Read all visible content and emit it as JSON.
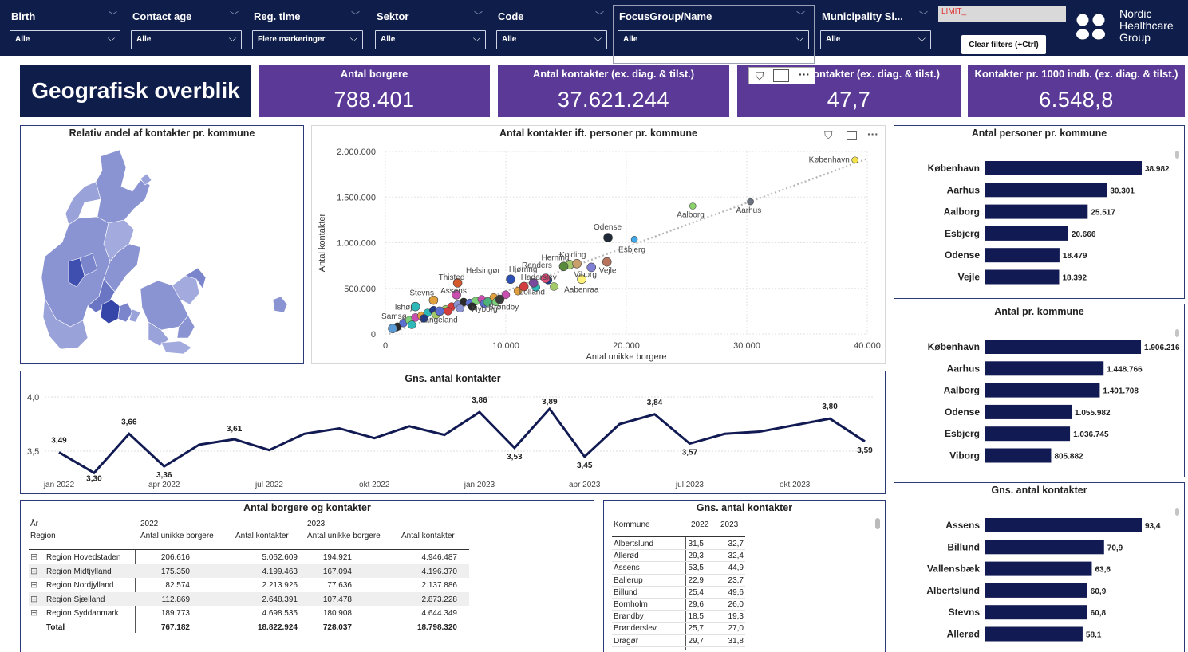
{
  "filters": [
    {
      "label": "Birth",
      "value": "Alle"
    },
    {
      "label": "Contact age",
      "value": "Alle"
    },
    {
      "label": "Reg. time",
      "value": "Flere markeringer"
    },
    {
      "label": "Sektor",
      "value": "Alle"
    },
    {
      "label": "Code",
      "value": "Alle"
    },
    {
      "label": "FocusGroup/Name",
      "value": "Alle"
    },
    {
      "label": "Municipality Si...",
      "value": "Alle"
    }
  ],
  "limit_label": "LIMIT_",
  "clear_filters": "Clear filters (+Ctrl)",
  "brand": {
    "line1": "Nordic",
    "line2": "Healthcare",
    "line3": "Group"
  },
  "page_title": "Geografisk overblik",
  "kpis": [
    {
      "title": "Antal borgere",
      "value": "788.401"
    },
    {
      "title": "Antal kontakter (ex. diag. & tilst.)",
      "value": "37.621.244"
    },
    {
      "title": "ontakter (ex. diag. & tilst.)",
      "value": "47,7"
    },
    {
      "title": "Kontakter pr. 1000 indb. (ex. diag. & tilst.)",
      "value": "6.548,8"
    }
  ],
  "map_title": "Relativ andel af kontakter pr. kommune",
  "scatter": {
    "title": "Antal kontakter ift. personer pr. kommune",
    "xlabel": "Antal unikke borgere",
    "ylabel": "Antal kontakter",
    "xticks": [
      "0",
      "10.000",
      "20.000",
      "30.000",
      "40.000"
    ],
    "yticks": [
      "0",
      "500.000",
      "1.000.000",
      "1.500.000",
      "2.000.000"
    ]
  },
  "line_title": "Gns. antal kontakter",
  "line_yticks": [
    "4,0",
    "3,5"
  ],
  "line_xticks": [
    "jan 2022",
    "apr 2022",
    "jul 2022",
    "okt 2022",
    "jan 2023",
    "apr 2023",
    "jul 2023",
    "okt 2023"
  ],
  "bar1_title": "Antal personer pr. kommune",
  "bar2_title": "Antal pr. kommune",
  "bar3_title": "Gns. antal kontakter",
  "table1": {
    "title": "Antal borgere og kontakter",
    "h_year": "År",
    "h_region": "Region",
    "y2022": "2022",
    "y2023": "2023",
    "c1": "Antal unikke borgere",
    "c2": "Antal kontakter",
    "rows": [
      {
        "r": "Region Hovedstaden",
        "a": "206.616",
        "b": "5.062.609",
        "c": "194.921",
        "d": "4.946.487"
      },
      {
        "r": "Region Midtjylland",
        "a": "175.350",
        "b": "4.199.463",
        "c": "167.094",
        "d": "4.196.370"
      },
      {
        "r": "Region Nordjylland",
        "a": "82.574",
        "b": "2.213.926",
        "c": "77.636",
        "d": "2.137.886"
      },
      {
        "r": "Region Sjælland",
        "a": "112.869",
        "b": "2.648.391",
        "c": "107.478",
        "d": "2.873.228"
      },
      {
        "r": "Region Syddanmark",
        "a": "189.773",
        "b": "4.698.535",
        "c": "180.908",
        "d": "4.644.349"
      }
    ],
    "total": {
      "r": "Total",
      "a": "767.182",
      "b": "18.822.924",
      "c": "728.037",
      "d": "18.798.320"
    }
  },
  "table2": {
    "title": "Gns. antal kontakter",
    "h_kommune": "Kommune",
    "h_2022": "2022",
    "h_2023": "2023",
    "rows": [
      {
        "k": "Albertslund",
        "a": "31,5",
        "b": "32,7"
      },
      {
        "k": "Allerød",
        "a": "29,3",
        "b": "32,4"
      },
      {
        "k": "Assens",
        "a": "53,5",
        "b": "44,9"
      },
      {
        "k": "Ballerup",
        "a": "22,9",
        "b": "23,7"
      },
      {
        "k": "Billund",
        "a": "25,4",
        "b": "49,6"
      },
      {
        "k": "Bornholm",
        "a": "29,6",
        "b": "26,0"
      },
      {
        "k": "Brøndby",
        "a": "18,5",
        "b": "19,3"
      },
      {
        "k": "Brønderslev",
        "a": "25,7",
        "b": "27,0"
      },
      {
        "k": "Dragør",
        "a": "29,7",
        "b": "31,8"
      }
    ]
  },
  "colors": {
    "navy": "#0f1d4a",
    "purple": "#5b3a97",
    "bar": "#111a52",
    "map": "#8590d0"
  },
  "chart_data": [
    {
      "type": "scatter",
      "title": "Antal kontakter ift. personer pr. kommune",
      "xlabel": "Antal unikke borgere",
      "ylabel": "Antal kontakter",
      "xlim": [
        0,
        40000
      ],
      "ylim": [
        0,
        2000000
      ],
      "trendline": true,
      "points": [
        {
          "label": "København",
          "x": 38982,
          "y": 1906216,
          "color": "#f2e14c"
        },
        {
          "label": "Aarhus",
          "x": 30301,
          "y": 1448766,
          "color": "#6b7280"
        },
        {
          "label": "Aalborg",
          "x": 25517,
          "y": 1401708,
          "color": "#8ad36b"
        },
        {
          "label": "Odense",
          "x": 18479,
          "y": 1055982,
          "color": "#1f2937"
        },
        {
          "label": "Esbjerg",
          "x": 20666,
          "y": 1036745,
          "color": "#3ea8e8"
        },
        {
          "label": "Randers",
          "x": 15300,
          "y": 760000,
          "color": "#a3c96b"
        },
        {
          "label": "Kolding",
          "x": 15900,
          "y": 770000,
          "color": "#c9a06b"
        },
        {
          "label": "Vejle",
          "x": 18392,
          "y": 790000,
          "color": "#b7735c"
        },
        {
          "label": "Herning",
          "x": 14800,
          "y": 740000,
          "color": "#5a8a3c"
        },
        {
          "label": "Viborg",
          "x": 17100,
          "y": 730000,
          "color": "#7f7fd5"
        },
        {
          "label": "Hjørring",
          "x": 13300,
          "y": 610000,
          "color": "#e04b7a"
        },
        {
          "label": "Aabenraa",
          "x": 16300,
          "y": 600000,
          "color": "#fff27a"
        },
        {
          "label": "Haderslev",
          "x": 12300,
          "y": 560000,
          "color": "#7a4b9c"
        },
        {
          "label": "Helsingør",
          "x": 10400,
          "y": 600000,
          "color": "#2b4fb3"
        },
        {
          "label": "Lolland",
          "x": 11500,
          "y": 520000,
          "color": "#d43d3d"
        },
        {
          "label": "Thisted",
          "x": 6000,
          "y": 560000,
          "color": "#d45a2b"
        },
        {
          "label": "Brøndby",
          "x": 9500,
          "y": 380000,
          "color": "#3a3a3a"
        },
        {
          "label": "Nyborg",
          "x": 8500,
          "y": 350000,
          "color": "#4bb37a"
        },
        {
          "label": "Assens",
          "x": 5900,
          "y": 430000,
          "color": "#c84fb0"
        },
        {
          "label": "Stevns",
          "x": 4000,
          "y": 370000,
          "color": "#e0a040"
        },
        {
          "label": "Langeland",
          "x": 4500,
          "y": 250000,
          "color": "#5a6fd0"
        },
        {
          "label": "Ishøj",
          "x": 2500,
          "y": 300000,
          "color": "#2fb8b8"
        },
        {
          "label": "Samsø",
          "x": 600,
          "y": 60000,
          "color": "#5b9bd5"
        }
      ]
    },
    {
      "type": "line",
      "title": "Gns. antal kontakter",
      "ylim": [
        3.3,
        4.0
      ],
      "x": [
        "jan 2022",
        "feb 2022",
        "mar 2022",
        "apr 2022",
        "maj 2022",
        "jun 2022",
        "jul 2022",
        "aug 2022",
        "sep 2022",
        "okt 2022",
        "nov 2022",
        "dec 2022",
        "jan 2023",
        "feb 2023",
        "mar 2023",
        "apr 2023",
        "maj 2023",
        "jun 2023",
        "jul 2023",
        "aug 2023",
        "sep 2023",
        "okt 2023",
        "nov 2023",
        "dec 2023"
      ],
      "series": [
        {
          "values": [
            3.49,
            3.3,
            3.66,
            3.36,
            3.56,
            3.61,
            3.51,
            3.66,
            3.71,
            3.62,
            3.73,
            3.65,
            3.86,
            3.53,
            3.89,
            3.45,
            3.75,
            3.84,
            3.57,
            3.66,
            3.68,
            3.74,
            3.8,
            3.59
          ]
        }
      ],
      "labeled_points": [
        "3,49",
        "3,30",
        "3,66",
        "3,36",
        "3,61",
        "3,86",
        "3,53",
        "3,89",
        "3,45",
        "3,84",
        "3,57",
        "3,80",
        "3,59"
      ]
    },
    {
      "type": "bar",
      "title": "Antal personer pr. kommune",
      "categories": [
        "København",
        "Aarhus",
        "Aalborg",
        "Esbjerg",
        "Odense",
        "Vejle"
      ],
      "values": [
        38982,
        30301,
        25517,
        20666,
        18479,
        18392
      ],
      "labels": [
        "38.982",
        "30.301",
        "25.517",
        "20.666",
        "18.479",
        "18.392"
      ]
    },
    {
      "type": "bar",
      "title": "Antal pr. kommune",
      "categories": [
        "København",
        "Aarhus",
        "Aalborg",
        "Odense",
        "Esbjerg",
        "Viborg"
      ],
      "values": [
        1906216,
        1448766,
        1401708,
        1055982,
        1036745,
        805882
      ],
      "labels": [
        "1.906.216",
        "1.448.766",
        "1.401.708",
        "1.055.982",
        "1.036.745",
        "805.882"
      ]
    },
    {
      "type": "bar",
      "title": "Gns. antal kontakter",
      "categories": [
        "Assens",
        "Billund",
        "Vallensbæk",
        "Albertslund",
        "Stevns",
        "Allerød"
      ],
      "values": [
        93.4,
        70.9,
        63.6,
        60.9,
        60.8,
        58.1
      ],
      "labels": [
        "93,4",
        "70,9",
        "63,6",
        "60,9",
        "60,8",
        "58,1"
      ]
    }
  ]
}
